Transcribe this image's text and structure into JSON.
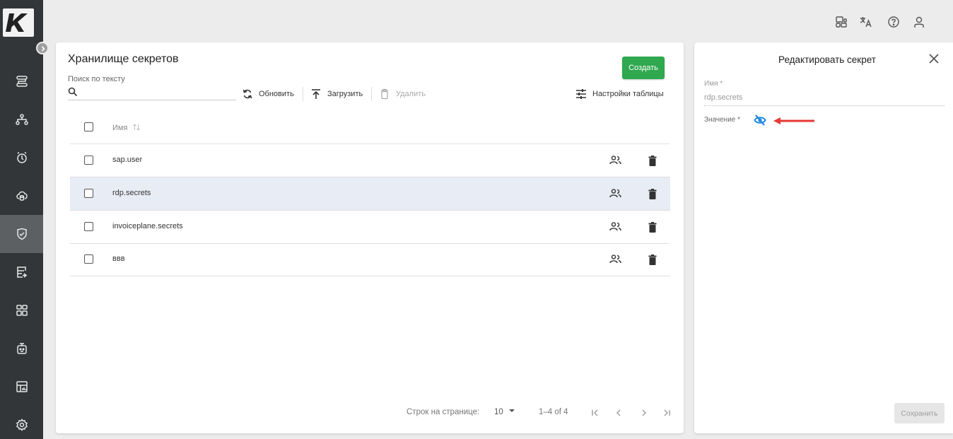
{
  "app": {
    "logo_text": "K"
  },
  "sidebar": {
    "items": [
      {
        "icon": "flow-icon"
      },
      {
        "icon": "hierarchy-icon"
      },
      {
        "icon": "alarm-icon"
      },
      {
        "icon": "cloud-database-icon"
      },
      {
        "icon": "shield-check-icon",
        "active": true
      },
      {
        "icon": "database-export-icon"
      },
      {
        "icon": "dashboard-icon"
      },
      {
        "icon": "robot-icon"
      },
      {
        "icon": "report-icon"
      },
      {
        "icon": "settings-icon"
      }
    ]
  },
  "topbar": {
    "icons": [
      "layout-icon",
      "translate-icon",
      "help-icon",
      "user-icon"
    ]
  },
  "main": {
    "title": "Хранилище секретов",
    "create_label": "Создать",
    "search_label": "Поиск по тексту",
    "search_value": "",
    "refresh_label": "Обновить",
    "upload_label": "Загрузить",
    "delete_label": "Удалить",
    "table_settings_label": "Настройки таблицы",
    "column_name": "Имя",
    "rows": [
      {
        "name": "sap.user",
        "selected": false
      },
      {
        "name": "rdp.secrets",
        "selected": true
      },
      {
        "name": "invoiceplane.secrets",
        "selected": false
      },
      {
        "name": "ввв",
        "selected": false
      }
    ],
    "pagination": {
      "rows_per_page_label": "Строк на странице:",
      "rows_per_page": "10",
      "range": "1–4 of 4"
    }
  },
  "edit_panel": {
    "title": "Редактировать секрет",
    "name_label": "Имя *",
    "name_value": "rdp.secrets",
    "value_label": "Значение *",
    "save_label": "Сохранить"
  },
  "colors": {
    "sidebar": "#323639",
    "accent_green": "#2fa84f",
    "eye_blue": "#1e88e5",
    "arrow_red": "#e53935",
    "row_selected": "#e8ecf5"
  }
}
